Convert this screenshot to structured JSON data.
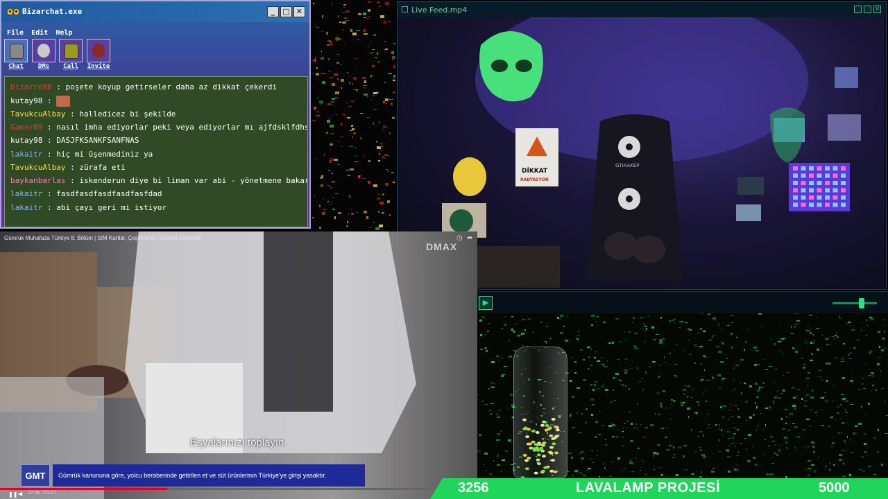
{
  "chat": {
    "title": "Bizarchat.exe",
    "window_buttons": {
      "minimize": "_",
      "maximize": "□",
      "close": "✕"
    },
    "menu": [
      "File",
      "Edit",
      "Help"
    ],
    "toolbar": [
      {
        "label": "Chat",
        "icon": "floppy-icon"
      },
      {
        "label": "DMs",
        "icon": "masked-face-icon"
      },
      {
        "label": "Call",
        "icon": "phone-display-icon"
      },
      {
        "label": "Invite",
        "icon": "pepper-icon"
      }
    ],
    "messages": [
      {
        "user": "bizarre88",
        "text": "poşete koyup getirseler daha az dikkat çekerdi",
        "user_color": "#e23a3a"
      },
      {
        "user": "kutay98",
        "text": "",
        "user_color": "#ffffff",
        "emote": "face-emote"
      },
      {
        "user": "TavukcuAlbay",
        "text": "halledicez bi şekilde",
        "user_color": "#f2e14a"
      },
      {
        "user": "Gamer69",
        "text": "nasıl imha ediyorlar peki veya ediyorlar mı ajfdsklfdhsdfh",
        "user_color": "#e23a3a"
      },
      {
        "user": "kutay98",
        "text": "DASJFKSANKFSANFNAS",
        "user_color": "#ffffff"
      },
      {
        "user": "lakaitr",
        "text": "hiç mi üşenmediniz ya",
        "user_color": "#8ab4ff"
      },
      {
        "user": "TavukcuAlbay",
        "text": "zürafa eti",
        "user_color": "#f2e14a"
      },
      {
        "user": "baykanbarlas",
        "text": "iskenderun diye bi liman var abi - yönetmene bakarak",
        "user_color": "#ff7ab8"
      },
      {
        "user": "lakaitr",
        "text": "fasdfasdfasdfasdfasfdad",
        "user_color": "#8ab4ff"
      },
      {
        "user": "lakaitr",
        "text": "abi çayı geri mi istiyor",
        "user_color": "#8ab4ff"
      }
    ]
  },
  "live": {
    "title": "Live Feed.mp4",
    "sign_line1": "DİKKAT",
    "sign_line2": "RADYASYON",
    "chair_text": "GTIAAKEP"
  },
  "video": {
    "title": "Gümrük Muhafaza Türkiye 8. Bölüm | SIM Kartlar, Çeşitli Etler, Şüpheli Otomobil",
    "channel_logo": "DMAX",
    "subtitle": "Eşyalarınızı toplayın.",
    "badge": "GMT",
    "info": "Gümrük kanununa göre, yolcu beraberinde getirilen et ve süt ürünlerinin Türkiye'ye girişi yasaktır.",
    "time": "17:56 / 51:07",
    "progress": 0.35
  },
  "bottom": {
    "volume": 0.66,
    "count_left": "3256",
    "title": "LAVALAMP PROJESİ",
    "count_right": "5000"
  },
  "colors": {
    "chat_bg": "#2f4a24",
    "accent_green": "#2be08f",
    "progress_red": "#e0002a",
    "ticker_green": "#1fd65a"
  }
}
